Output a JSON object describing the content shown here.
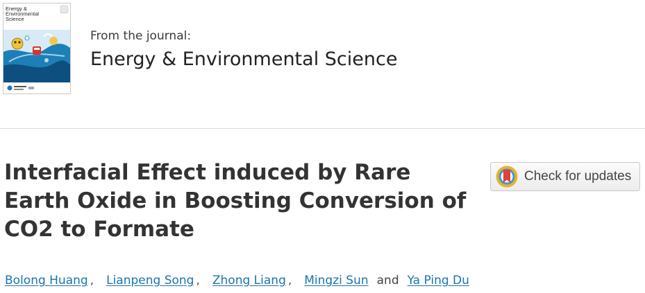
{
  "journal": {
    "from_label": "From the journal:",
    "name": "Energy & Environmental Science",
    "cover": {
      "title_lines": [
        "Energy &",
        "Environmental",
        "Science"
      ],
      "colors": {
        "sky": "#ffffff",
        "water": "#1d7fb5",
        "deep_water": "#0d4f7e",
        "accent_red": "#d9342b",
        "accent_yellow": "#f2c230",
        "logo_blue": "#2a6fb0"
      }
    }
  },
  "article": {
    "title": "Interfacial Effect induced by Rare Earth Oxide in Boosting Conversion of CO2 to Formate"
  },
  "check_updates": {
    "label": "Check for updates",
    "icon": "crossmark-icon",
    "colors": {
      "ring_outer": "#e6b32c",
      "ring_inner": "#3c9ad6",
      "bookmark": "#e0413a"
    }
  },
  "authors": {
    "list": [
      "Bolong Huang",
      "Lianpeng Song",
      "Zhong Liang",
      "Mingzi Sun",
      "Ya Ping Du"
    ],
    "separator": ",",
    "conjunction": "and",
    "link_color": "#1a74ad"
  }
}
